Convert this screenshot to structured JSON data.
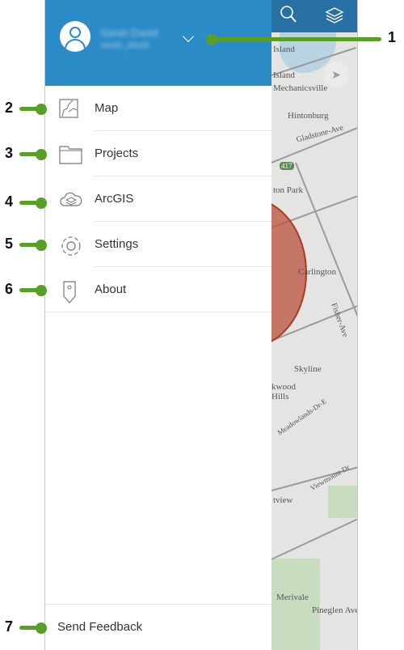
{
  "header": {
    "user_name": "Sarah David",
    "user_id": "sarah_david"
  },
  "menu": {
    "items": [
      {
        "label": "Map",
        "icon": "map-icon"
      },
      {
        "label": "Projects",
        "icon": "folder-icon"
      },
      {
        "label": "ArcGIS",
        "icon": "cloud-layers-icon"
      },
      {
        "label": "Settings",
        "icon": "gear-icon"
      },
      {
        "label": "About",
        "icon": "info-pin-icon"
      }
    ],
    "feedback_label": "Send Feedback"
  },
  "map": {
    "labels": [
      "Island",
      "Island",
      "Mechanicsville",
      "Hintonburg",
      "Gladstone-Ave",
      "417",
      "Carlington",
      "ton Park",
      "Fisher-Ave",
      "Skyline",
      "kwood Hills",
      "Meadowlands-Dr-E",
      "Viewmount-Dr",
      "tview",
      "Merivale",
      "Pineglen Ave"
    ]
  },
  "callouts": [
    "1",
    "2",
    "3",
    "4",
    "5",
    "6",
    "7"
  ],
  "colors": {
    "header": "#2b8bc7",
    "callout": "#5a9e2a",
    "buffer": "#be5a46"
  }
}
